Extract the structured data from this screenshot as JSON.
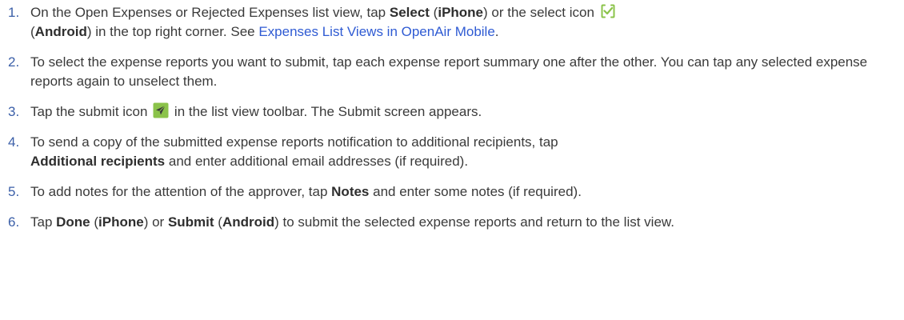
{
  "steps": [
    {
      "num": "1.",
      "t1": "On the Open Expenses or Rejected Expenses list view, tap ",
      "b1": "Select",
      "t2": " (",
      "b2": "iPhone",
      "t3": ") or the select icon ",
      "t4": " (",
      "b3": "Android",
      "t5": ") in the top right corner. See ",
      "link": "Expenses List Views in OpenAir Mobile",
      "t6": "."
    },
    {
      "num": "2.",
      "text": "To select the expense reports you want to submit, tap each expense report summary one after the other. You can tap any selected expense reports again to unselect them."
    },
    {
      "num": "3.",
      "t1": "Tap the submit icon ",
      "t2": " in the list view toolbar. The Submit screen appears."
    },
    {
      "num": "4.",
      "t1": "To send a copy of the submitted expense reports notification to additional recipients, tap ",
      "b1": "Additional recipients",
      "t2": " and enter additional email addresses (if required)."
    },
    {
      "num": "5.",
      "t1": "To add notes for the attention of the approver, tap ",
      "b1": "Notes",
      "t2": " and enter some notes (if required)."
    },
    {
      "num": "6.",
      "t1": "Tap ",
      "b1": "Done",
      "t2": " (",
      "b2": "iPhone",
      "t3": ") or ",
      "b3": "Submit",
      "t4": " (",
      "b4": "Android",
      "t5": ") to submit the selected expense reports and return to the list view."
    }
  ],
  "icons": {
    "select_icon": "select-checkbox-icon",
    "submit_icon": "submit-paper-plane-icon"
  },
  "colors": {
    "number": "#3b5fa8",
    "link": "#2f5bd3",
    "icon_green": "#8bc34a",
    "text": "#3a3a3a"
  }
}
